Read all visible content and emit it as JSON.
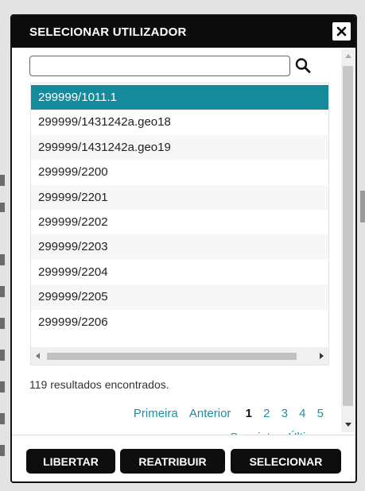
{
  "dialog": {
    "title": "SELECIONAR UTILIZADOR",
    "close_icon": "close-x-icon"
  },
  "search": {
    "value": "",
    "placeholder": "",
    "icon": "search-icon"
  },
  "list": {
    "items": [
      "299999/1011.1",
      "299999/1431242a.geo18",
      "299999/1431242a.geo19",
      "299999/2200",
      "299999/2201",
      "299999/2202",
      "299999/2203",
      "299999/2204",
      "299999/2205",
      "299999/2206"
    ],
    "selected_index": 0
  },
  "results": {
    "text": "119 resultados encontrados."
  },
  "pagination": {
    "first": "Primeira",
    "previous": "Anterior",
    "current": "1",
    "pages": [
      "2",
      "3",
      "4",
      "5"
    ],
    "next": "Seguinte",
    "last": "Última"
  },
  "footer": {
    "release_label": "LIBERTAR",
    "reassign_label": "REATRIBUIR",
    "select_label": "SELECIONAR"
  },
  "colors": {
    "accent": "#148a9a",
    "link": "#1d8fa0",
    "titlebar": "#0c0c0c",
    "button": "#0d0d0d"
  }
}
